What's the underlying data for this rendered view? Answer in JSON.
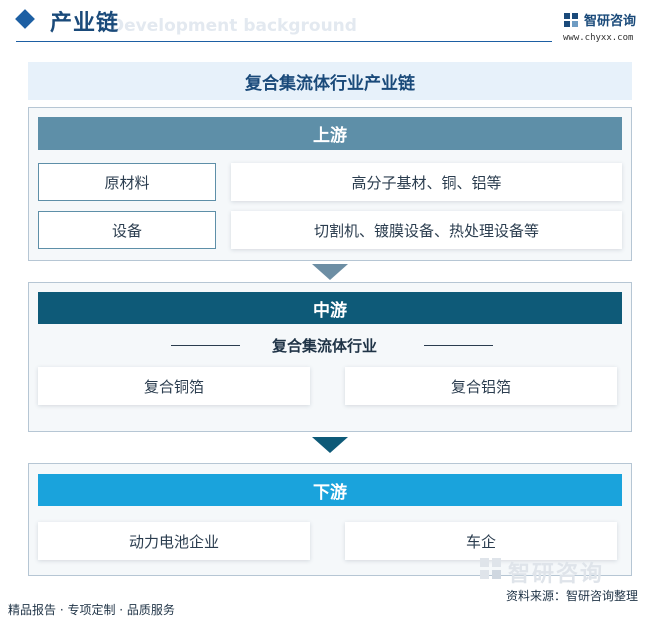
{
  "header": {
    "title": "产业链",
    "ghost_text": "Development background",
    "logo_text": "智研咨询",
    "logo_url": "www.chyxx.com"
  },
  "diagram_title": "复合集流体行业产业链",
  "upstream": {
    "heading": "上游",
    "rows": [
      {
        "category": "原材料",
        "detail": "高分子基材、铜、铝等"
      },
      {
        "category": "设备",
        "detail": "切割机、镀膜设备、热处理设备等"
      }
    ]
  },
  "midstream": {
    "heading": "中游",
    "subtitle": "复合集流体行业",
    "items": [
      "复合铜箔",
      "复合铝箔"
    ]
  },
  "downstream": {
    "heading": "下游",
    "items": [
      "动力电池企业",
      "车企"
    ]
  },
  "footer": {
    "services": "精品报告 · 专项定制 · 品质服务",
    "source": "资料来源：智研咨询整理",
    "watermark": "智研咨询"
  },
  "colors": {
    "upstream_head": "#5e8fa8",
    "midstream_head": "#0e5a78",
    "downstream_head": "#1aa3dc",
    "accent": "#1d5fa3"
  }
}
